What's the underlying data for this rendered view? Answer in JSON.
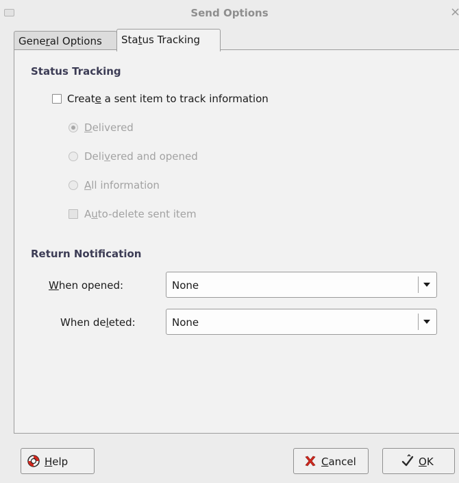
{
  "window": {
    "title": "Send Options",
    "close_glyph": "×"
  },
  "tabs": [
    {
      "pre": "Gene",
      "mn": "r",
      "post": "al Options",
      "selected": false
    },
    {
      "pre": "Sta",
      "mn": "t",
      "post": "us  Tracking",
      "selected": true
    }
  ],
  "status_tracking": {
    "heading": "Status Tracking",
    "create_sent_item": {
      "pre": "Creat",
      "mn": "e",
      "post": " a sent item to track information",
      "checked": false
    },
    "options": [
      {
        "pre": "",
        "mn": "D",
        "post": "elivered",
        "selected": true
      },
      {
        "pre": "Deli",
        "mn": "v",
        "post": "ered and opened",
        "selected": false
      },
      {
        "pre": "",
        "mn": "A",
        "post": "ll information",
        "selected": false
      }
    ],
    "auto_delete": {
      "pre": "A",
      "mn": "u",
      "post": "to-delete sent item",
      "checked": false
    }
  },
  "return_notification": {
    "heading": "Return Notification",
    "when_opened": {
      "pre": "",
      "mn": "W",
      "post": "hen opened:",
      "value": "None"
    },
    "when_deleted": {
      "pre": "When de",
      "mn": "l",
      "post": "eted:",
      "value": "None"
    }
  },
  "buttons": {
    "help": {
      "pre": "",
      "mn": "H",
      "post": "elp",
      "icon": "lifebuoy-icon"
    },
    "cancel": {
      "pre": "",
      "mn": "C",
      "post": "ancel",
      "icon": "red-x-icon"
    },
    "ok": {
      "pre": "",
      "mn": "O",
      "post": "K",
      "icon": "checkmark-hand-icon"
    }
  },
  "colors": {
    "heading": "#3c3c55",
    "disabled_text": "#a2a2a2",
    "cancel_icon": "#d0281e",
    "help_icon": "#d0281e"
  }
}
